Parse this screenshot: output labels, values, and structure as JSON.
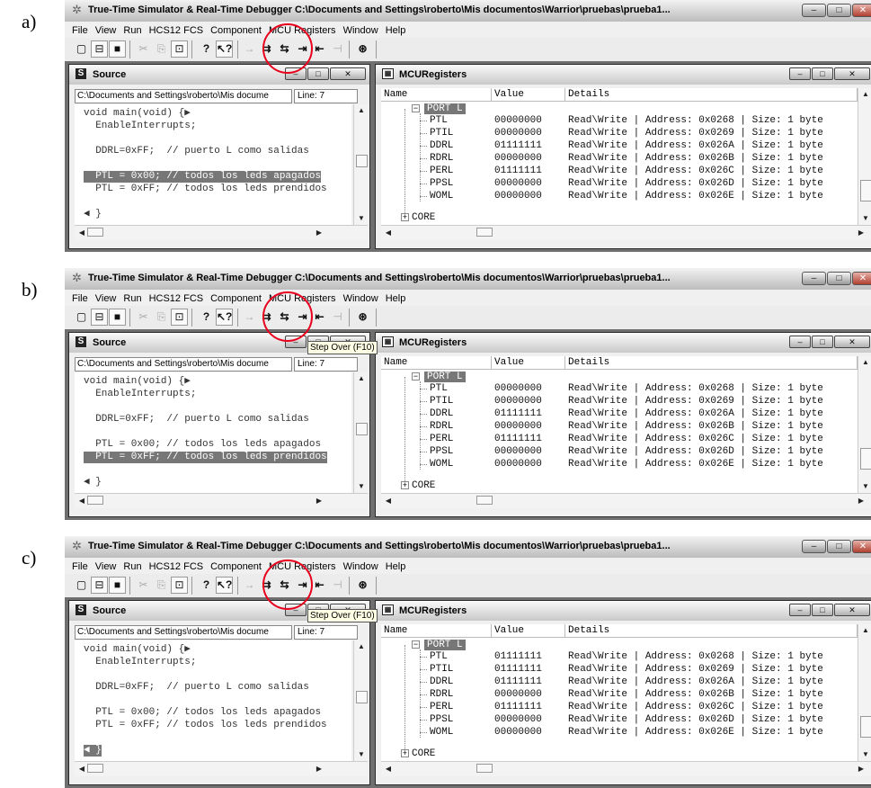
{
  "app": {
    "title": "True-Time Simulator & Real-Time Debugger   C:\\Documents and Settings\\roberto\\Mis documentos\\Warrior\\pruebas\\prueba1...",
    "menu": [
      "File",
      "View",
      "Run",
      "HCS12 FCS",
      "Component",
      "MCU Registers",
      "Window",
      "Help"
    ],
    "window_buttons": {
      "minimize": "–",
      "maximize": "□",
      "close": "✕"
    }
  },
  "source": {
    "title": "Source",
    "path": "C:\\Documents and Settings\\roberto\\Mis docume",
    "line": "Line: 7",
    "code": [
      "void main(void) {▶",
      "  EnableInterrupts;",
      "",
      "  DDRL=0xFF;  // puerto L como salidas",
      "",
      "  PTL = 0x00; // todos los leds apagados",
      "  PTL = 0xFF; // todos los leds prendidos",
      "",
      "◀ }"
    ]
  },
  "registers": {
    "title": "MCURegisters",
    "columns": [
      "Name",
      "Value",
      "Details"
    ],
    "group": "PORT L",
    "collapsed_group": "CORE",
    "names": [
      "PTL",
      "PTIL",
      "DDRL",
      "RDRL",
      "PERL",
      "PPSL",
      "WOML"
    ],
    "details": [
      "Read\\Write | Address: 0x0268 | Size: 1 byte",
      "Read\\Write | Address: 0x0269 | Size: 1 byte",
      "Read\\Write | Address: 0x026A | Size: 1 byte",
      "Read\\Write | Address: 0x026B | Size: 1 byte",
      "Read\\Write | Address: 0x026C | Size: 1 byte",
      "Read\\Write | Address: 0x026D | Size: 1 byte",
      "Read\\Write | Address: 0x026E | Size: 1 byte"
    ]
  },
  "panels": [
    {
      "label": "a)",
      "highlighted_line": 5,
      "tooltip": "",
      "values": [
        "00000000",
        "00000000",
        "01111111",
        "00000000",
        "01111111",
        "00000000",
        "00000000"
      ]
    },
    {
      "label": "b)",
      "highlighted_line": 6,
      "tooltip": "Step Over (F10)",
      "values": [
        "00000000",
        "00000000",
        "01111111",
        "00000000",
        "01111111",
        "00000000",
        "00000000"
      ]
    },
    {
      "label": "c)",
      "highlighted_line": 8,
      "tooltip": "Step Over (F10)",
      "values": [
        "01111111",
        "01111111",
        "01111111",
        "00000000",
        "01111111",
        "00000000",
        "00000000"
      ]
    }
  ],
  "colors": {
    "highlight_circle": "#e8001c",
    "selection": "#777777"
  }
}
